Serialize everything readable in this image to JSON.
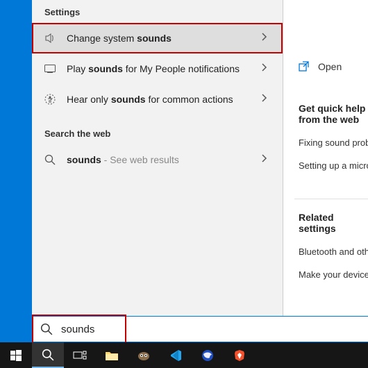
{
  "headers": {
    "settings": "Settings",
    "searchweb": "Search the web"
  },
  "results": {
    "r0": {
      "pre": "Change system ",
      "bold": "sounds",
      "post": ""
    },
    "r1": {
      "pre": "Play ",
      "bold": "sounds",
      "post": " for My People notifications"
    },
    "r2": {
      "pre": "Hear only ",
      "bold": "sounds",
      "post": " for common actions"
    },
    "web": {
      "bold": "sounds",
      "sub": " - See web results"
    }
  },
  "right": {
    "open": "Open",
    "quick_head": "Get quick help from the web",
    "quick1": "Fixing sound problems",
    "quick2": "Setting up a microphone",
    "rel_head": "Related settings",
    "rel1": "Bluetooth and other devices",
    "rel2": "Make your device easier to hear"
  },
  "search": {
    "value": "sounds"
  }
}
